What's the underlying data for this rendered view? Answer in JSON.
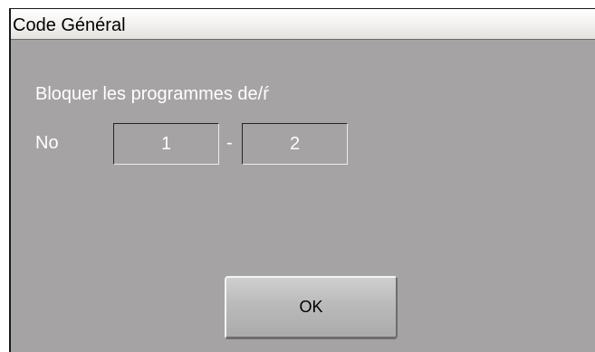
{
  "window": {
    "title": "Code Général"
  },
  "form": {
    "prompt": "Bloquer les programmes de/ŕ",
    "number_label": "No",
    "range_start": "1",
    "range_separator": "-",
    "range_end": "2"
  },
  "buttons": {
    "ok_label": "OK"
  },
  "colors": {
    "background": "#a6a3a4",
    "text": "#ffffff",
    "title_bar": "#f1f0ee"
  }
}
